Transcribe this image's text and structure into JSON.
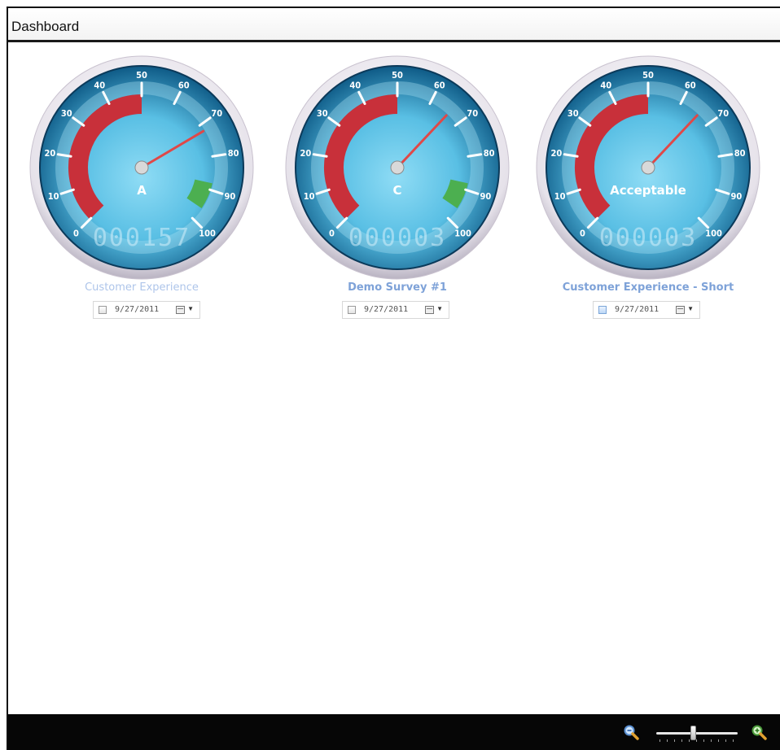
{
  "window": {
    "title": "Dashboard"
  },
  "gauges": [
    {
      "label": "Customer Experience",
      "score": 72,
      "grade": "A",
      "counter": "000157",
      "date": "9/27/2011",
      "red_band": [
        0,
        50
      ],
      "green_band": [
        88,
        96
      ]
    },
    {
      "label": "Demo Survey #1",
      "score": 66,
      "grade": "C",
      "counter": "000003",
      "date": "9/27/2011",
      "red_band": [
        0,
        50
      ],
      "green_band": [
        88,
        96
      ]
    },
    {
      "label": "Customer Experience - Short",
      "score": 66,
      "grade": "Acceptable",
      "counter": "000003",
      "date": "9/27/2011",
      "red_band": [
        0,
        50
      ],
      "green_band": null
    }
  ],
  "scale": {
    "min": 0,
    "max": 100,
    "ticks": [
      "0",
      "10",
      "20",
      "30",
      "40",
      "50",
      "60",
      "70",
      "80",
      "90",
      "100"
    ]
  },
  "colors": {
    "red_band": "#c8303a",
    "green_band": "#4caf50",
    "needle": "#e04848",
    "label_text": "#7ea2d8",
    "dial_dark": "#0e5a86",
    "dial_light": "#59bfe4"
  },
  "zoom": {
    "level": 0.45,
    "zoom_out_icon": "zoom-out-icon",
    "zoom_in_icon": "zoom-in-icon"
  }
}
